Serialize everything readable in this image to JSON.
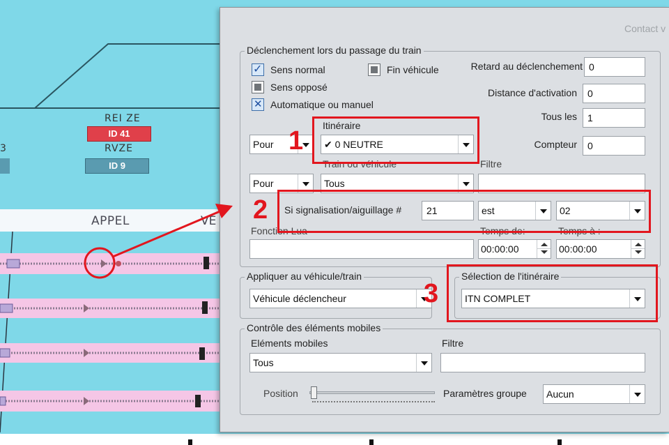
{
  "background": {
    "station_top": "REI ZE",
    "badge_red": "ID 41",
    "station_bottom": "RVZE",
    "badge_blue": "ID 9",
    "left_number": "3",
    "track_label": "APPEL",
    "track_label_right": "VE",
    "colors": {
      "sky": "#7fd8e8",
      "rail": "#f5c6e6",
      "badge_red": "#e0404a",
      "badge_blue": "#5a9bb0"
    }
  },
  "dialog": {
    "contact_text": "Contact v",
    "trigger": {
      "legend": "Déclenchement lors du passage du train",
      "sens_normal": "Sens normal",
      "sens_oppose": "Sens opposé",
      "automatique": "Automatique ou manuel",
      "fin_vehicule": "Fin véhicule",
      "retard_label": "Retard au déclenchement",
      "retard_value": "0",
      "distance_label": "Distance d'activation",
      "distance_value": "0",
      "tous_les_label": "Tous les",
      "tous_les_value": "1",
      "compteur_label": "Compteur",
      "compteur_value": "0",
      "pour_1": "Pour",
      "itineraire_label": "Itinéraire",
      "itineraire_value": "✔ 0 NEUTRE",
      "pour_2": "Pour",
      "train_label": "Train ou véhicule",
      "train_value": "Tous",
      "filtre_label": "Filtre",
      "filtre_value": "",
      "signal_label": "Si signalisation/aiguillage #",
      "signal_value": "21",
      "est_value": "est",
      "state_value": "02",
      "fonction_label": "Fonction Lua",
      "fonction_value": "",
      "temps_de_label": "Temps de:",
      "temps_de_value": "00:00:00",
      "temps_a_label": "Temps à :",
      "temps_a_value": "00:00:00"
    },
    "apply": {
      "legend": "Appliquer au véhicule/train",
      "value": "Véhicule déclencheur"
    },
    "selection": {
      "legend": "Sélection de l'itinéraire",
      "value": "ITN COMPLET"
    },
    "mobile": {
      "legend": "Contrôle des éléments mobiles",
      "elements_label": "Eléments mobiles",
      "elements_value": "Tous",
      "filtre_label": "Filtre",
      "filtre_value": "",
      "position_label": "Position",
      "params_label": "Paramètres groupe",
      "params_value": "Aucun",
      "position_level": 0
    }
  },
  "annotations": {
    "num1": "1",
    "num2": "2",
    "num3": "3",
    "color": "#e2161e"
  }
}
